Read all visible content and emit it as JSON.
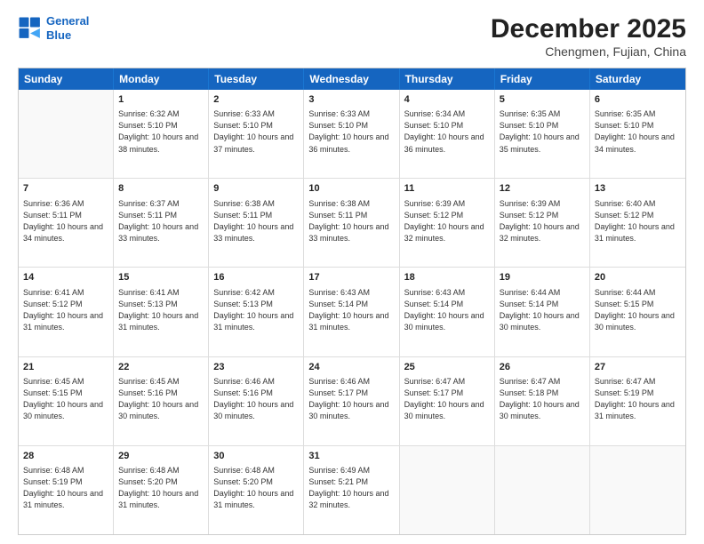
{
  "header": {
    "logo_line1": "General",
    "logo_line2": "Blue",
    "month_year": "December 2025",
    "location": "Chengmen, Fujian, China"
  },
  "days_of_week": [
    "Sunday",
    "Monday",
    "Tuesday",
    "Wednesday",
    "Thursday",
    "Friday",
    "Saturday"
  ],
  "weeks": [
    [
      {
        "day": "",
        "sunrise": "",
        "sunset": "",
        "daylight": ""
      },
      {
        "day": "1",
        "sunrise": "Sunrise: 6:32 AM",
        "sunset": "Sunset: 5:10 PM",
        "daylight": "Daylight: 10 hours and 38 minutes."
      },
      {
        "day": "2",
        "sunrise": "Sunrise: 6:33 AM",
        "sunset": "Sunset: 5:10 PM",
        "daylight": "Daylight: 10 hours and 37 minutes."
      },
      {
        "day": "3",
        "sunrise": "Sunrise: 6:33 AM",
        "sunset": "Sunset: 5:10 PM",
        "daylight": "Daylight: 10 hours and 36 minutes."
      },
      {
        "day": "4",
        "sunrise": "Sunrise: 6:34 AM",
        "sunset": "Sunset: 5:10 PM",
        "daylight": "Daylight: 10 hours and 36 minutes."
      },
      {
        "day": "5",
        "sunrise": "Sunrise: 6:35 AM",
        "sunset": "Sunset: 5:10 PM",
        "daylight": "Daylight: 10 hours and 35 minutes."
      },
      {
        "day": "6",
        "sunrise": "Sunrise: 6:35 AM",
        "sunset": "Sunset: 5:10 PM",
        "daylight": "Daylight: 10 hours and 34 minutes."
      }
    ],
    [
      {
        "day": "7",
        "sunrise": "Sunrise: 6:36 AM",
        "sunset": "Sunset: 5:11 PM",
        "daylight": "Daylight: 10 hours and 34 minutes."
      },
      {
        "day": "8",
        "sunrise": "Sunrise: 6:37 AM",
        "sunset": "Sunset: 5:11 PM",
        "daylight": "Daylight: 10 hours and 33 minutes."
      },
      {
        "day": "9",
        "sunrise": "Sunrise: 6:38 AM",
        "sunset": "Sunset: 5:11 PM",
        "daylight": "Daylight: 10 hours and 33 minutes."
      },
      {
        "day": "10",
        "sunrise": "Sunrise: 6:38 AM",
        "sunset": "Sunset: 5:11 PM",
        "daylight": "Daylight: 10 hours and 33 minutes."
      },
      {
        "day": "11",
        "sunrise": "Sunrise: 6:39 AM",
        "sunset": "Sunset: 5:12 PM",
        "daylight": "Daylight: 10 hours and 32 minutes."
      },
      {
        "day": "12",
        "sunrise": "Sunrise: 6:39 AM",
        "sunset": "Sunset: 5:12 PM",
        "daylight": "Daylight: 10 hours and 32 minutes."
      },
      {
        "day": "13",
        "sunrise": "Sunrise: 6:40 AM",
        "sunset": "Sunset: 5:12 PM",
        "daylight": "Daylight: 10 hours and 31 minutes."
      }
    ],
    [
      {
        "day": "14",
        "sunrise": "Sunrise: 6:41 AM",
        "sunset": "Sunset: 5:12 PM",
        "daylight": "Daylight: 10 hours and 31 minutes."
      },
      {
        "day": "15",
        "sunrise": "Sunrise: 6:41 AM",
        "sunset": "Sunset: 5:13 PM",
        "daylight": "Daylight: 10 hours and 31 minutes."
      },
      {
        "day": "16",
        "sunrise": "Sunrise: 6:42 AM",
        "sunset": "Sunset: 5:13 PM",
        "daylight": "Daylight: 10 hours and 31 minutes."
      },
      {
        "day": "17",
        "sunrise": "Sunrise: 6:43 AM",
        "sunset": "Sunset: 5:14 PM",
        "daylight": "Daylight: 10 hours and 31 minutes."
      },
      {
        "day": "18",
        "sunrise": "Sunrise: 6:43 AM",
        "sunset": "Sunset: 5:14 PM",
        "daylight": "Daylight: 10 hours and 30 minutes."
      },
      {
        "day": "19",
        "sunrise": "Sunrise: 6:44 AM",
        "sunset": "Sunset: 5:14 PM",
        "daylight": "Daylight: 10 hours and 30 minutes."
      },
      {
        "day": "20",
        "sunrise": "Sunrise: 6:44 AM",
        "sunset": "Sunset: 5:15 PM",
        "daylight": "Daylight: 10 hours and 30 minutes."
      }
    ],
    [
      {
        "day": "21",
        "sunrise": "Sunrise: 6:45 AM",
        "sunset": "Sunset: 5:15 PM",
        "daylight": "Daylight: 10 hours and 30 minutes."
      },
      {
        "day": "22",
        "sunrise": "Sunrise: 6:45 AM",
        "sunset": "Sunset: 5:16 PM",
        "daylight": "Daylight: 10 hours and 30 minutes."
      },
      {
        "day": "23",
        "sunrise": "Sunrise: 6:46 AM",
        "sunset": "Sunset: 5:16 PM",
        "daylight": "Daylight: 10 hours and 30 minutes."
      },
      {
        "day": "24",
        "sunrise": "Sunrise: 6:46 AM",
        "sunset": "Sunset: 5:17 PM",
        "daylight": "Daylight: 10 hours and 30 minutes."
      },
      {
        "day": "25",
        "sunrise": "Sunrise: 6:47 AM",
        "sunset": "Sunset: 5:17 PM",
        "daylight": "Daylight: 10 hours and 30 minutes."
      },
      {
        "day": "26",
        "sunrise": "Sunrise: 6:47 AM",
        "sunset": "Sunset: 5:18 PM",
        "daylight": "Daylight: 10 hours and 30 minutes."
      },
      {
        "day": "27",
        "sunrise": "Sunrise: 6:47 AM",
        "sunset": "Sunset: 5:19 PM",
        "daylight": "Daylight: 10 hours and 31 minutes."
      }
    ],
    [
      {
        "day": "28",
        "sunrise": "Sunrise: 6:48 AM",
        "sunset": "Sunset: 5:19 PM",
        "daylight": "Daylight: 10 hours and 31 minutes."
      },
      {
        "day": "29",
        "sunrise": "Sunrise: 6:48 AM",
        "sunset": "Sunset: 5:20 PM",
        "daylight": "Daylight: 10 hours and 31 minutes."
      },
      {
        "day": "30",
        "sunrise": "Sunrise: 6:48 AM",
        "sunset": "Sunset: 5:20 PM",
        "daylight": "Daylight: 10 hours and 31 minutes."
      },
      {
        "day": "31",
        "sunrise": "Sunrise: 6:49 AM",
        "sunset": "Sunset: 5:21 PM",
        "daylight": "Daylight: 10 hours and 32 minutes."
      },
      {
        "day": "",
        "sunrise": "",
        "sunset": "",
        "daylight": ""
      },
      {
        "day": "",
        "sunrise": "",
        "sunset": "",
        "daylight": ""
      },
      {
        "day": "",
        "sunrise": "",
        "sunset": "",
        "daylight": ""
      }
    ]
  ]
}
